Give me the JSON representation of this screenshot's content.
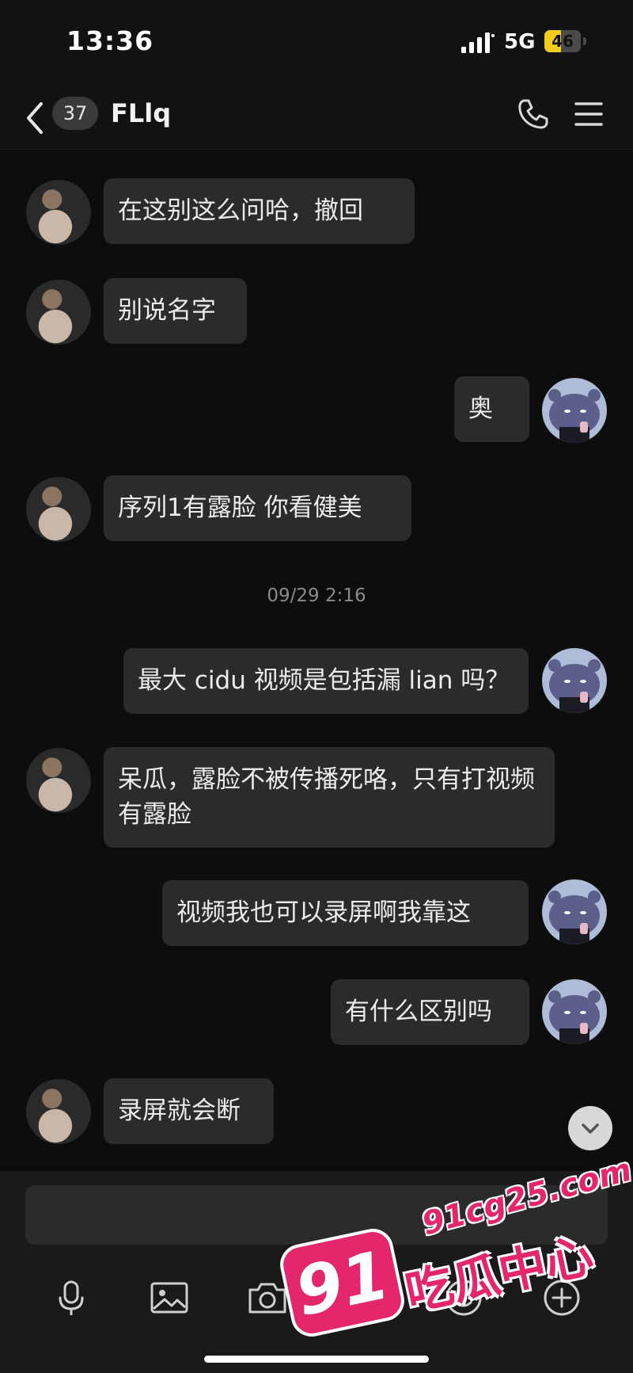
{
  "status_bar": {
    "time": "13:36",
    "network": "5G",
    "battery": 46
  },
  "nav": {
    "back_icon": "chevron-left-icon",
    "unread_count": "37",
    "contact_name": "FLlq",
    "phone_icon": "phone-icon",
    "menu_icon": "hamburger-menu-icon"
  },
  "messages": [
    {
      "from": "other",
      "text": "在这别这么问哈，撤回"
    },
    {
      "from": "other",
      "text": "别说名字"
    },
    {
      "from": "me",
      "text": "奥"
    },
    {
      "from": "other",
      "text": "序列1有露脸 你看健美"
    },
    {
      "timestamp": "09/29 2:16"
    },
    {
      "from": "me",
      "text": "最大 cidu 视频是包括漏 lian 吗？"
    },
    {
      "from": "other",
      "text": "呆瓜，露脸不被传播死咯，只有打视频有露脸"
    },
    {
      "from": "me",
      "text": "视频我也可以录屏啊我靠这"
    },
    {
      "from": "me",
      "text": "有什么区别吗"
    },
    {
      "from": "other",
      "text": "录屏就会断"
    }
  ],
  "composer": {
    "input_value": "",
    "tools": [
      "microphone-icon",
      "image-icon",
      "camera-icon",
      "red-packet-icon",
      "emoji-icon",
      "plus-icon"
    ]
  },
  "watermark": {
    "number": "91",
    "url": "91cg25.com",
    "brand": "吃瓜中心"
  },
  "colors": {
    "background": "#0d0d0d",
    "bubble": "#2b2b2b",
    "battery": "#f2cc1d",
    "watermark": "#e4266c"
  }
}
